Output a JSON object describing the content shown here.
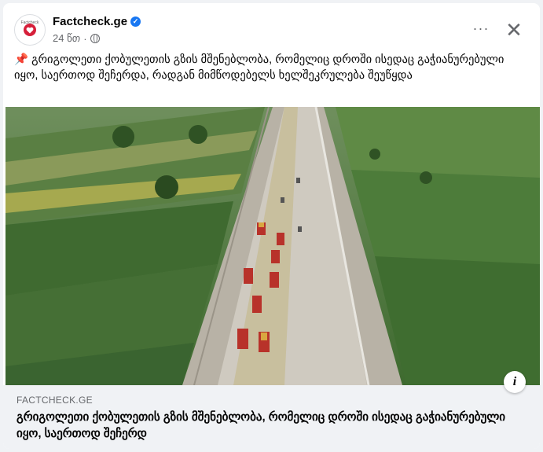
{
  "post": {
    "page_name": "Factcheck.ge",
    "avatar_label": "Factcheck",
    "time": "24 წთ",
    "separator": "·",
    "pin_emoji": "📌",
    "text": "გრიგოლეთი ქობულეთის გზის მშენებლობა, რომელიც დროში ისედაც გაჭიანურებული იყო, საერთოდ შეჩერდა, რადგან მიმწოდებელს ხელშეკრულება შეუწყდა",
    "more_label": "···",
    "close_label": "✕",
    "verified_glyph": "✓"
  },
  "link_preview": {
    "domain": "FACTCHECK.GE",
    "title": "გრიგოლეთი ქობულეთის გზის მშენებლობა, რომელიც დროში ისედაც გაჭიანურებული იყო, საერთოდ შეჩერდ",
    "info_glyph": "i"
  },
  "icons": {
    "verified": "verified-badge-icon",
    "globe": "globe-icon",
    "more": "more-options-icon",
    "close": "close-icon",
    "info": "info-icon",
    "pin": "pushpin-icon"
  },
  "colors": {
    "accent": "#1877f2",
    "brand": "#d61f3a",
    "text": "#050505",
    "muted": "#65676b",
    "link_bg": "#f0f2f5"
  }
}
